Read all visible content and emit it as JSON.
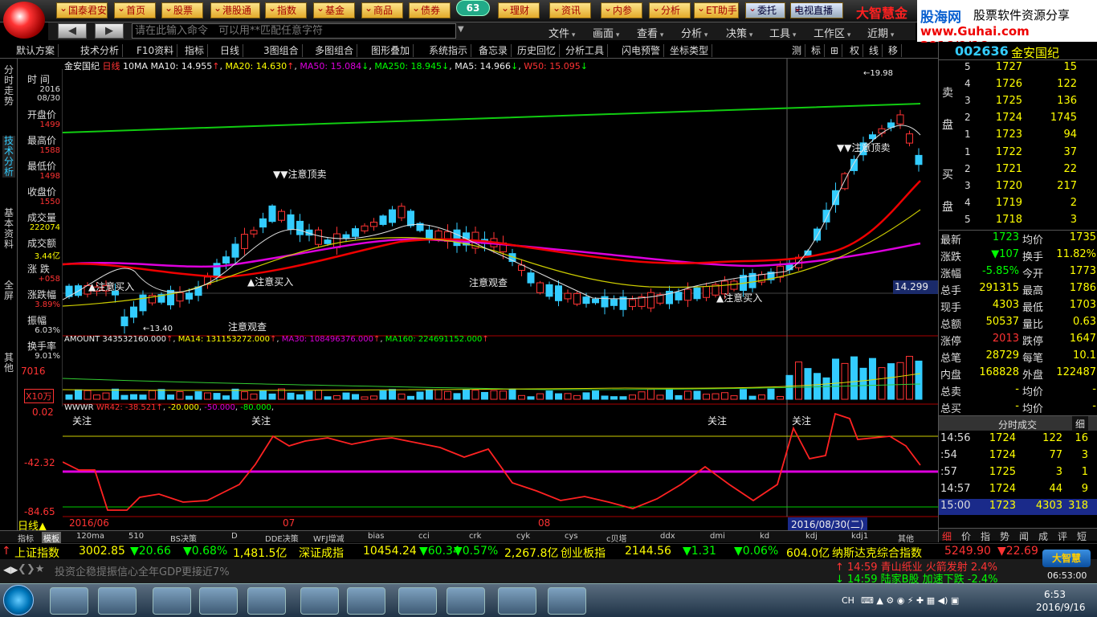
{
  "top_buttons": [
    "国泰君安",
    "首页",
    "股票",
    "港股通",
    "指数",
    "基金",
    "商品",
    "债券",
    "理财",
    "资讯",
    "内参",
    "分析",
    "ET助手",
    "委托",
    "电视直播"
  ],
  "badge": "63",
  "brand": "大智慧金",
  "guhai": {
    "name": "股海网",
    "slogan": "股票软件资源分享",
    "url": "www.Guhai.com 2016/9/16"
  },
  "command_placeholder": "请在此输入命令　可以用**匹配任意字符",
  "menus": [
    "文件",
    "画面",
    "查看",
    "分析",
    "决策",
    "工具",
    "工作区",
    "近期"
  ],
  "toolbar": [
    "默认方案",
    "技术分析",
    "F10资料",
    "指标",
    "日线",
    "3图组合",
    "多图组合",
    "图形叠加",
    "系统指示",
    "备忘录",
    "历史回忆",
    "分析工具",
    "闪电预警",
    "坐标类型"
  ],
  "toolbar_right": [
    "测",
    "标",
    "⊞",
    "权",
    "线",
    "移"
  ],
  "vtabs": [
    "分时走势",
    "技术分析",
    "基本资料",
    "全屏",
    "其他"
  ],
  "info_labels": [
    "时 间",
    "开盘价",
    "最高价",
    "最低价",
    "收盘价",
    "成交量",
    "成交额",
    "涨 跌",
    "涨跌幅",
    "振幅",
    "换手率"
  ],
  "info_values": [
    "2016 08/30",
    "1499",
    "1588",
    "1498",
    "1550",
    "222074",
    "3.44亿",
    "+058",
    "3.89%",
    "6.03%",
    "9.01%"
  ],
  "ma_line": {
    "name": "金安国纪",
    "period": "日线",
    "ma10": "10MA",
    "ma10_label": "MA10: 14.955",
    "ma20": "MA20: 14.630",
    "ma50": "MA50: 15.084",
    "ma250": "MA250: 18.945",
    "ma5": "MA5: 14.966",
    "w50": "W50: 15.095"
  },
  "chart_annotations": {
    "buy1": "注意买入",
    "buy2": "注意买入",
    "buy3": "注意买入",
    "watch1": "注意观查",
    "watch2": "注意观查",
    "sell1": "注意顶卖",
    "sell2": "注意顶卖",
    "low": "13.40",
    "high": "19.98",
    "price_tag": "14.299"
  },
  "volume_line": {
    "amount": "AMOUNT 343532160.000",
    "ma14": "MA14: 131153272.000",
    "ma30": "MA30: 108496376.000",
    "ma160": "MA160: 224691152.000"
  },
  "volume_axis": {
    "top": "7016",
    "unit": "X10万"
  },
  "wr_line": {
    "name": "WWWR",
    "wr42": "WR42: -38.521",
    "l1": "-20.000",
    "l2": "-50.000",
    "l3": "-80.000"
  },
  "wr_axis": [
    "0.02",
    "-42.32",
    "-84.65"
  ],
  "wr_flags": [
    "关注",
    "关注",
    "关注",
    "关注"
  ],
  "date_axis": {
    "d1": "2016/06",
    "d2": "07",
    "d3": "08",
    "sel": "2016/08/30(二)"
  },
  "period_label": "日线▲",
  "bottom_tabs": [
    "指标",
    "模板",
    "120ma",
    "510",
    "BS决策",
    "D",
    "DDE决策",
    "WFJ增减",
    "bias",
    "cci",
    "crk",
    "cyk",
    "cys",
    "c贝塔",
    "ddx",
    "dmi",
    "kd",
    "kdj",
    "kdj1",
    "其他"
  ],
  "quote": {
    "code": "002636",
    "name": "金安国纪"
  },
  "sell": [
    {
      "n": "5",
      "p": "1727",
      "v": "15"
    },
    {
      "n": "4",
      "p": "1726",
      "v": "122"
    },
    {
      "n": "3",
      "p": "1725",
      "v": "136"
    },
    {
      "n": "2",
      "p": "1724",
      "v": "1745"
    },
    {
      "n": "1",
      "p": "1723",
      "v": "94"
    }
  ],
  "buy": [
    {
      "n": "1",
      "p": "1722",
      "v": "37"
    },
    {
      "n": "2",
      "p": "1721",
      "v": "22"
    },
    {
      "n": "3",
      "p": "1720",
      "v": "217"
    },
    {
      "n": "4",
      "p": "1719",
      "v": "2"
    },
    {
      "n": "5",
      "p": "1718",
      "v": "3"
    }
  ],
  "sell_label": "卖 盘",
  "buy_label": "买 盘",
  "stats": [
    {
      "l1": "最新",
      "v1": "1723",
      "l2": "均价",
      "v2": "1735"
    },
    {
      "l1": "涨跌",
      "v1": "▼107",
      "l2": "换手",
      "v2": "11.82%"
    },
    {
      "l1": "涨幅",
      "v1": "-5.85%",
      "l2": "今开",
      "v2": "1773"
    },
    {
      "l1": "总手",
      "v1": "291315",
      "l2": "最高",
      "v2": "1786"
    },
    {
      "l1": "现手",
      "v1": "4303",
      "l2": "最低",
      "v2": "1703"
    },
    {
      "l1": "总额",
      "v1": "50537",
      "l2": "量比",
      "v2": "0.63"
    },
    {
      "l1": "涨停",
      "v1": "2013",
      "l2": "跌停",
      "v2": "1647"
    },
    {
      "l1": "总笔",
      "v1": "28729",
      "l2": "每笔",
      "v2": "10.1"
    },
    {
      "l1": "内盘",
      "v1": "168828",
      "l2": "外盘",
      "v2": "122487"
    },
    {
      "l1": "总卖",
      "v1": "-",
      "l2": "均价",
      "v2": "-"
    },
    {
      "l1": "总买",
      "v1": "-",
      "l2": "均价",
      "v2": "-"
    }
  ],
  "ticks_title": "分时成交",
  "ticks_tab": "细",
  "ticks": [
    {
      "t": "14:56",
      "p": "1724",
      "v": "122",
      "n": "16"
    },
    {
      "t": ":54",
      "p": "1724",
      "v": "77",
      "n": "3"
    },
    {
      "t": ":57",
      "p": "1725",
      "v": "3",
      "n": "1"
    },
    {
      "t": "14:57",
      "p": "1724",
      "v": "44",
      "n": "9"
    },
    {
      "t": "15:00",
      "p": "1723",
      "v": "4303",
      "n": "318"
    }
  ],
  "rp_tabs": [
    "细",
    "价",
    "指",
    "势",
    "闻",
    "成",
    "评",
    "短"
  ],
  "ticker": [
    {
      "n": "上证指数",
      "v": "3002.85",
      "c": "▼20.66",
      "p": "▼0.68%",
      "a": "1,481.5亿"
    },
    {
      "n": "深证成指",
      "v": "10454.24",
      "c": "▼60.34",
      "p": "▼0.57%",
      "a": "2,267.8亿"
    },
    {
      "n": "创业板指",
      "v": "2144.56",
      "c": "▼1.31",
      "p": "▼0.06%",
      "a": "604.0亿"
    },
    {
      "n": "纳斯达克综合指数",
      "v": "5249.90",
      "c": "▼22.69"
    }
  ],
  "news_text": "投资企稳提振信心全年GDP更接近7%",
  "alerts": [
    "14:59 青山纸业 火箭发射 2.4%",
    "14:59 陆家B股 加速下跌 -2.4%"
  ],
  "dzh_badge": "大智慧",
  "clock_small": "06:53:00",
  "tray": {
    "lang": "CH",
    "time": "6:53",
    "date": "2016/9/16"
  }
}
